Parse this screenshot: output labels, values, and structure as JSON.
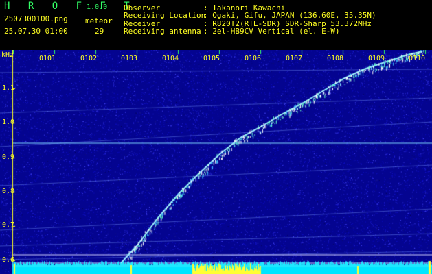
{
  "header": {
    "app_name": "H R O F F T",
    "version": "1.0.0",
    "file_name": "2507300100.png",
    "datetime": "25.07.30 01:00",
    "meteor_label": "meteor",
    "meteor_count": "29",
    "info": [
      {
        "label": "Observer",
        "value": ": Takanori Kawachi"
      },
      {
        "label": "Receiving Location",
        "value": ": Ogaki, Gifu, JAPAN (136.60E, 35.35N)"
      },
      {
        "label": "Receiver",
        "value": ": R820T2(RTL-SDR) SDR-Sharp 53.372MHz"
      },
      {
        "label": "Receiving antenna",
        "value": ": 2el-HB9CV Vertical (el. E-W)"
      }
    ]
  },
  "axes": {
    "unit": "kHz",
    "y_ticks": [
      "1.1",
      "1.0",
      "0.9",
      "0.8",
      "0.7",
      "0.6"
    ],
    "x_ticks": [
      "0101",
      "0102",
      "0103",
      "0104",
      "0105",
      "0106",
      "0107",
      "0108",
      "0109",
      "0110"
    ]
  },
  "colors": {
    "background": "#000000",
    "text_yellow": "#ffff22",
    "text_green": "#33ff66",
    "spectrum_bg": "#040490",
    "trace": "#7ee8ff",
    "baseline": "#00e5ff"
  }
}
